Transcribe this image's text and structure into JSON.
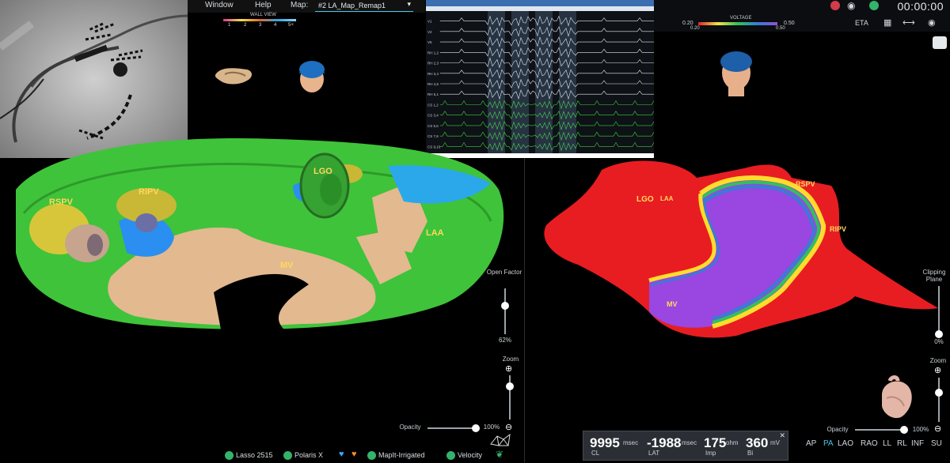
{
  "menu": {
    "window": "Window",
    "help": "Help",
    "map_label": "Map:",
    "map_value": "#2 LA_Map_Remap1"
  },
  "wall_view": {
    "title": "WALL VIEW",
    "ticks": [
      "1",
      "2",
      "3",
      "4",
      "5+"
    ]
  },
  "voltage": {
    "title": "VOLTAGE",
    "min": "0.20",
    "max": "0.50",
    "min2": "0.20",
    "max2": "0.50"
  },
  "toolbar_right": {
    "eta": "ETA",
    "timer": "00:00:00"
  },
  "left_map_labels": {
    "rspv": "RSPV",
    "ripv": "RIPV",
    "lgo": "LGO",
    "laa": "LAA",
    "mv": "MV"
  },
  "right_map_labels": {
    "lgo": "LGO",
    "laa": "LAA",
    "rspv": "RSPV",
    "ripv": "RIPV",
    "mv": "MV"
  },
  "left_controls": {
    "open_factor": "Open Factor",
    "open_factor_value": "62%",
    "zoom": "Zoom",
    "opacity": "Opacity",
    "opacity_value": "100%"
  },
  "right_controls": {
    "clipping": "Clipping Plane",
    "clipping_value": "0%",
    "zoom": "Zoom",
    "opacity": "Opacity",
    "opacity_value": "100%"
  },
  "status": {
    "lasso": "Lasso 2515",
    "polaris": "Polaris X",
    "mapit": "MapIt-Irrigated",
    "velocity": "Velocity"
  },
  "readout": {
    "cl_value": "9995",
    "cl_unit": "msec",
    "cl_label": "CL",
    "lat_value": "-1988",
    "lat_unit": "msec",
    "lat_label": "LAT",
    "imp_value": "175",
    "imp_unit": "ohm",
    "imp_label": "Imp",
    "bi_value": "360",
    "bi_unit": "mV",
    "bi_label": "Bi"
  },
  "views": [
    "AP",
    "PA",
    "LAO",
    "RAO",
    "LL",
    "RL",
    "INF",
    "SU"
  ],
  "active_view": "PA",
  "egm_channels": [
    "V1",
    "V2",
    "V5",
    "RH 1,2",
    "RH 2,3",
    "RH 3,4",
    "RH 4,5",
    "RH 5,1",
    "CS 1,2",
    "CS 3,4",
    "CS 5,6",
    "CS 7,8",
    "CS 9,10"
  ],
  "colors": {
    "accent": "#4fc1e9",
    "green": "#33b36b",
    "label": "#ffd85c"
  }
}
